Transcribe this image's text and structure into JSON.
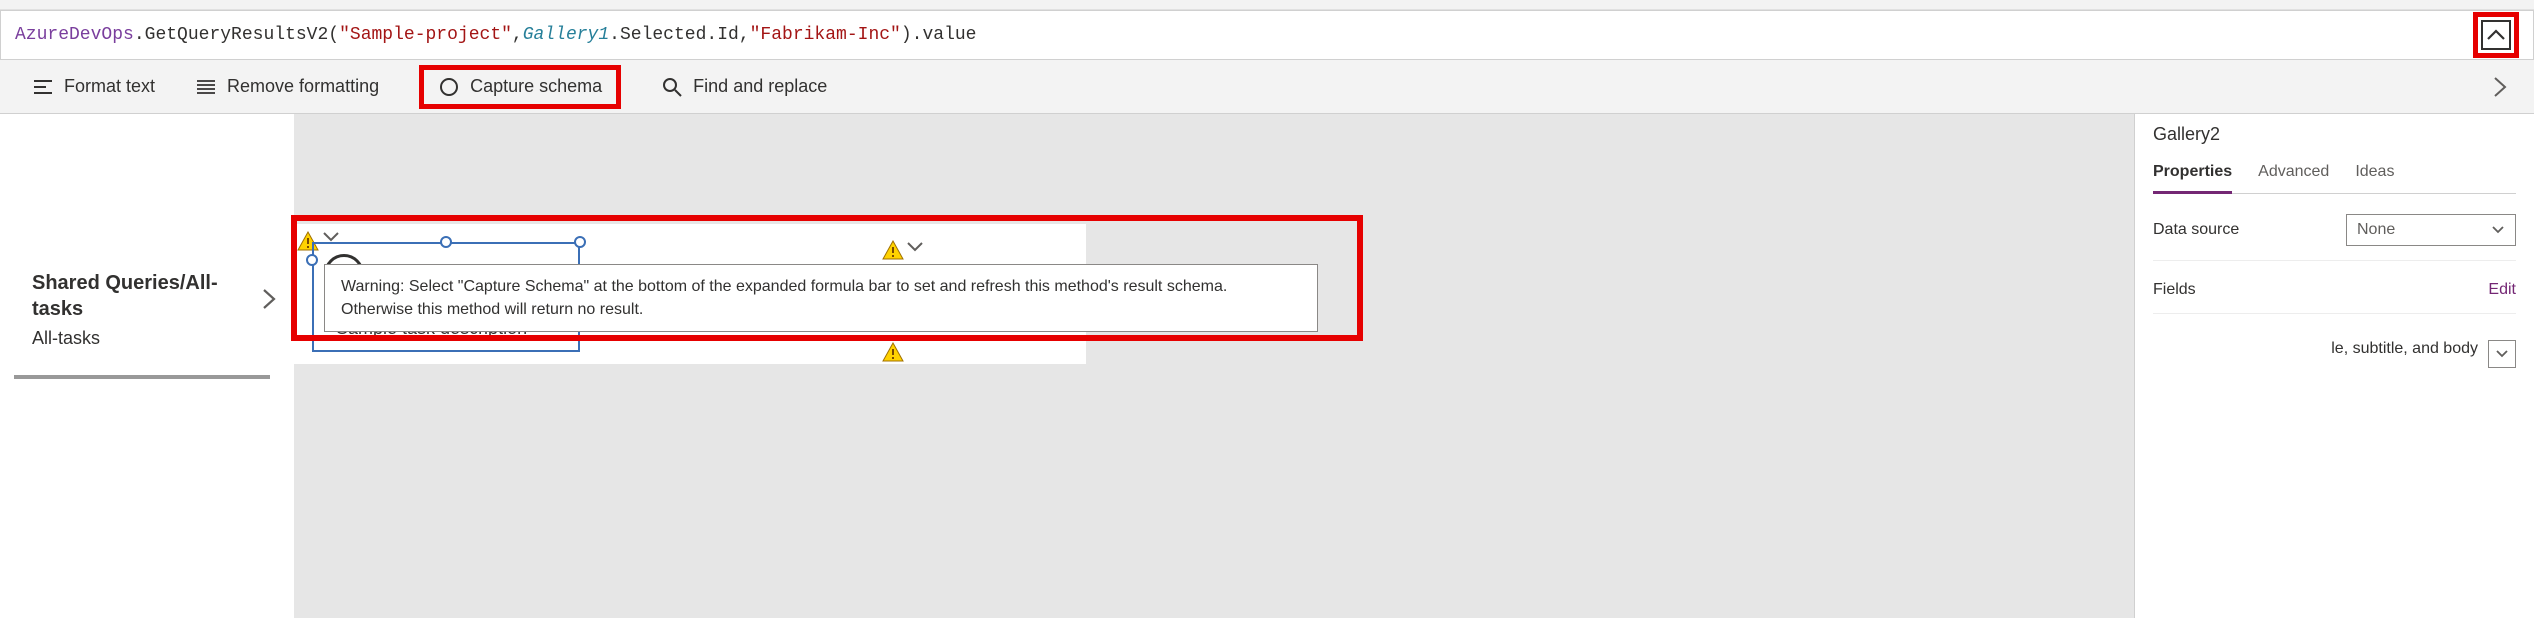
{
  "formula": {
    "obj": "AzureDevOps",
    "func": "GetQueryResultsV2",
    "arg1": "\"Sample-project\"",
    "galleryRef": "Gallery1",
    "selected": "Selected",
    "id": "Id",
    "arg3": "\"Fabrikam-Inc\"",
    "tail": "value"
  },
  "toolbar": {
    "format": "Format text",
    "remove": "Remove formatting",
    "capture": "Capture schema",
    "find": "Find and replace"
  },
  "tree": {
    "title": "Shared Queries/All-tasks",
    "subtitle": "All-tasks"
  },
  "canvas": {
    "sample_desc": "Sample task description"
  },
  "tooltip": {
    "text": "Warning: Select \"Capture Schema\" at the bottom of the expanded formula bar to set and refresh this method's result schema. Otherwise this method will return no result."
  },
  "rightPanel": {
    "title": "Gallery2",
    "tabs": {
      "properties": "Properties",
      "advanced": "Advanced",
      "ideas": "Ideas"
    },
    "dataSourceLabel": "Data source",
    "dataSourceValue": "None",
    "fieldsLabel": "Fields",
    "editLink": "Edit",
    "layoutValue": "le, subtitle, and body"
  }
}
